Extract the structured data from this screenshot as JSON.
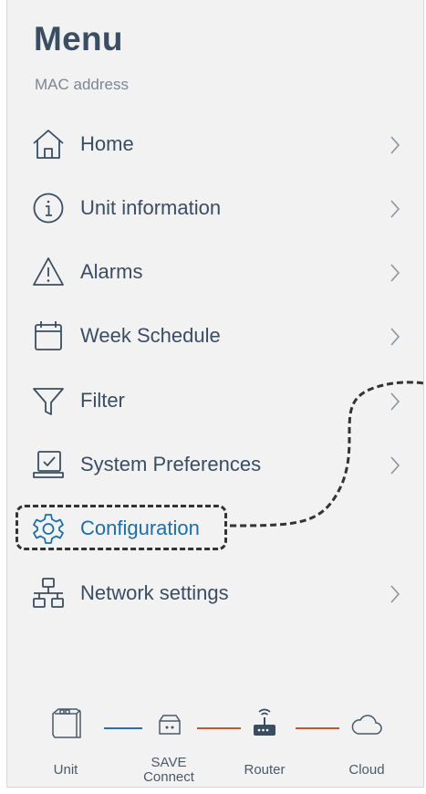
{
  "menu": {
    "title": "Menu",
    "subtitle": "MAC address",
    "items": [
      {
        "label": "Home",
        "icon": "home-icon"
      },
      {
        "label": "Unit information",
        "icon": "info-icon"
      },
      {
        "label": "Alarms",
        "icon": "warning-icon"
      },
      {
        "label": "Week Schedule",
        "icon": "calendar-icon"
      },
      {
        "label": "Filter",
        "icon": "filter-icon"
      },
      {
        "label": "System Preferences",
        "icon": "laptop-check-icon"
      },
      {
        "label": "Configuration",
        "icon": "gear-icon",
        "highlighted": true
      },
      {
        "label": "Network settings",
        "icon": "network-icon"
      }
    ]
  },
  "devices": [
    {
      "label": "Unit",
      "icon": "unit-icon"
    },
    {
      "label": "SAVE\nConnect",
      "icon": "save-connect-icon"
    },
    {
      "label": "Router",
      "icon": "router-icon"
    },
    {
      "label": "Cloud",
      "icon": "cloud-icon"
    }
  ],
  "colors": {
    "text": "#3b4d63",
    "accent": "#1b6fa6",
    "link_blue": "#2f6ea5",
    "link_red": "#c0563a"
  }
}
